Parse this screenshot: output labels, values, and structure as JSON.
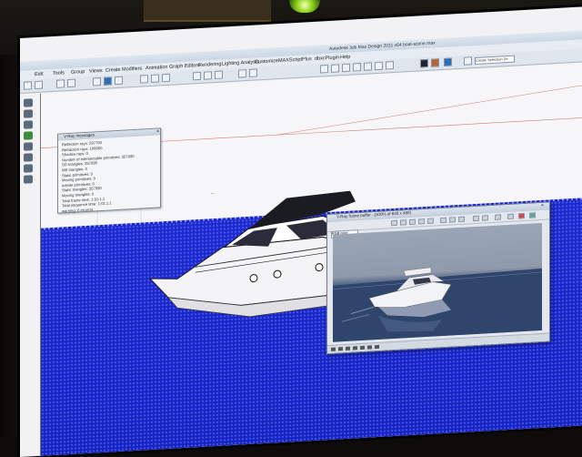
{
  "window": {
    "app_title": "Autodesk 3ds Max Design 2011 x64   boat-scene.max"
  },
  "menu": {
    "items": [
      "Edit",
      "Tools",
      "Group",
      "Views",
      "Create",
      "Modifiers",
      "Animation",
      "Graph Editors",
      "Rendering",
      "Lighting Analysis",
      "Customize",
      "MAXScript",
      "Plus",
      "dbxcPlugin",
      "Help"
    ]
  },
  "toolbar": {
    "selection_set_value": "Create Selection Se"
  },
  "stats_window": {
    "title": "V-Ray messages",
    "lines": [
      "Reflection rays: 297760",
      "Refraction rays: 189960",
      "Shadow rays: 0",
      "Number of intersectable primitives: 357990",
      "SD triangles: 357990",
      "MB triangles: 0",
      "Static primitives: 0",
      "Moving primitives: 0",
      "Infinite primitives: 0",
      "Static triangles: 357990",
      "Moving triangles: 0",
      "Total frame time: 1:01:1.1",
      "Total sequence time: 1:01:1.1",
      "warning: 0 error(s)"
    ]
  },
  "frame_buffer": {
    "title": "V-Ray frame buffer - [100% of 640 x 480]",
    "channel": "RGB color"
  },
  "colors": {
    "water": "#1424c4",
    "background": "#f6f6f8"
  }
}
